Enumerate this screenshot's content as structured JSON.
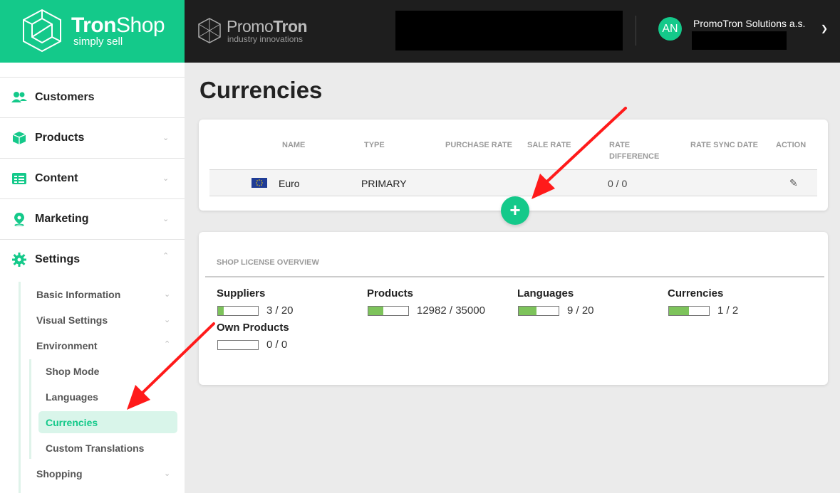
{
  "brand": {
    "name_bold": "Tron",
    "name_light": "Shop",
    "tagline": "simply sell"
  },
  "partner": {
    "name_light": "Promo",
    "name_bold": "Tron",
    "tagline": "industry innovations"
  },
  "user": {
    "initials": "AN",
    "company": "PromoTron Solutions a.s."
  },
  "sidebar": {
    "items": [
      {
        "label": "Customers",
        "icon": "users-icon",
        "has_chevron": false
      },
      {
        "label": "Products",
        "icon": "box-icon",
        "has_chevron": true
      },
      {
        "label": "Content",
        "icon": "content-icon",
        "has_chevron": true
      },
      {
        "label": "Marketing",
        "icon": "map-pin-icon",
        "has_chevron": true
      },
      {
        "label": "Settings",
        "icon": "gear-icon",
        "has_chevron": true,
        "expanded": true
      }
    ],
    "settings_sub": [
      {
        "label": "Basic Information"
      },
      {
        "label": "Visual Settings"
      },
      {
        "label": "Environment"
      },
      {
        "label": "Shopping"
      }
    ],
    "environment_sub": [
      {
        "label": "Shop Mode"
      },
      {
        "label": "Languages"
      },
      {
        "label": "Currencies",
        "active": true
      },
      {
        "label": "Custom Translations"
      }
    ]
  },
  "page": {
    "title": "Currencies"
  },
  "currencies_table": {
    "headers": [
      "NAME",
      "TYPE",
      "PURCHASE RATE",
      "SALE RATE",
      "RATE DIFFERENCE",
      "RATE SYNC DATE",
      "ACTION"
    ],
    "rows": [
      {
        "flag": "eu-flag",
        "name": "Euro",
        "type": "PRIMARY",
        "purchase_rate": "",
        "sale_rate": "",
        "rate_difference": "0 / 0",
        "rate_sync_date": ""
      }
    ],
    "add_label": "+"
  },
  "license": {
    "title": "SHOP LICENSE OVERVIEW",
    "items": [
      {
        "name": "Suppliers",
        "value": "3 / 20",
        "used": 3,
        "limit": 20
      },
      {
        "name": "Products",
        "value": "12982 / 35000",
        "used": 12982,
        "limit": 35000
      },
      {
        "name": "Languages",
        "value": "9 / 20",
        "used": 9,
        "limit": 20
      },
      {
        "name": "Currencies",
        "value": "1 / 2",
        "used": 1,
        "limit": 2
      },
      {
        "name": "Own Products",
        "value": "0 / 0",
        "used": 0,
        "limit": 0
      }
    ]
  },
  "colors": {
    "accent": "#14c98a",
    "topbar": "#1e1e1e",
    "bar_fill": "#7dc35b",
    "annotation_arrow": "#ff1a1a"
  }
}
